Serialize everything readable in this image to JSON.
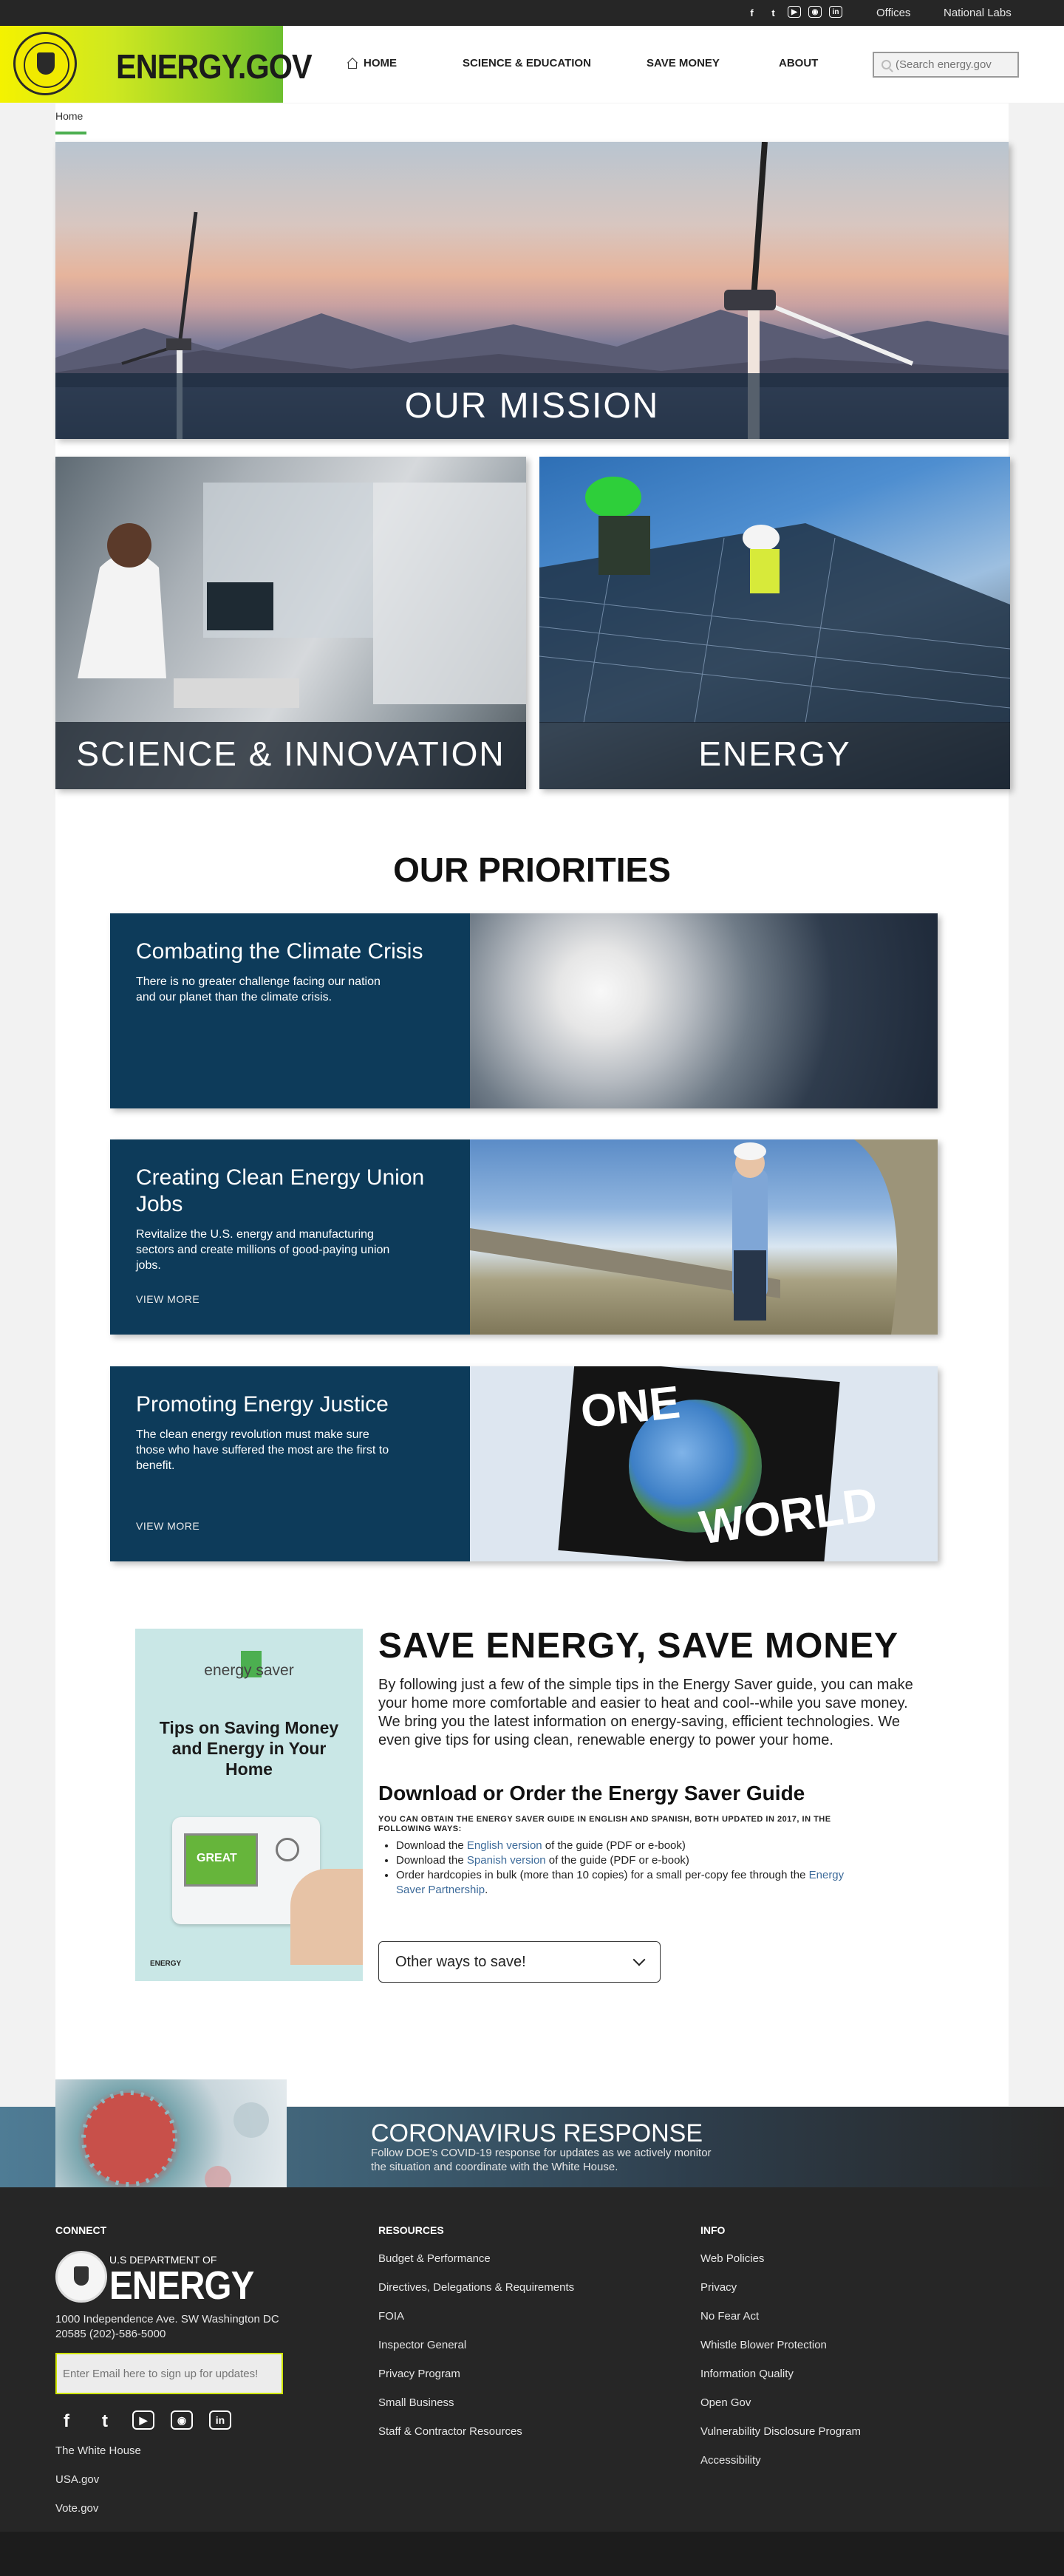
{
  "topbar": {
    "social_icons": [
      "f",
      "t",
      "▶",
      "◉",
      "in"
    ],
    "links": [
      "Offices",
      "National Labs"
    ]
  },
  "header": {
    "logo_text": "ENERGY.GOV",
    "nav": [
      "HOME",
      "SCIENCE & EDUCATION",
      "SAVE MONEY",
      "ABOUT"
    ],
    "search_placeholder": "(Search energy.gov"
  },
  "breadcrumb": "Home",
  "mission": {
    "title": "OUR MISSION"
  },
  "tiles": [
    "SCIENCE & INNOVATION",
    "ENERGY"
  ],
  "priorities": {
    "title": "OUR PRIORITIES",
    "cards": [
      {
        "title": "Combating the Climate Crisis",
        "text": "There is no greater challenge facing our nation and our planet than the climate crisis.",
        "more": ""
      },
      {
        "title": "Creating Clean Energy Union Jobs",
        "text": "Revitalize the U.S. energy and manufacturing sectors and create millions of good-paying union jobs.",
        "more": "VIEW MORE"
      },
      {
        "title": "Promoting Energy Justice",
        "text": "The clean energy revolution must make sure those who have suffered the most are the first to benefit.",
        "more": "VIEW MORE"
      }
    ],
    "world_image_text": [
      "ONE",
      "WORLD"
    ]
  },
  "saver": {
    "cover_brand": "energy saver",
    "cover_title": "Tips on Saving Money and Energy in Your Home",
    "cover_screen": "GREAT",
    "cover_footer": "ENERGY",
    "heading": "SAVE ENERGY, SAVE MONEY",
    "intro": "By following just a few of the simple tips in the Energy Saver guide, you can make your home more comfortable and easier to heat and cool--while you save money. We bring you the latest information on energy-saving, efficient technologies. We even give tips for using clean, renewable energy to power your home.",
    "subheading": "Download or Order the Energy Saver Guide",
    "small_caps": "YOU CAN OBTAIN THE ENERGY SAVER GUIDE IN ENGLISH AND SPANISH, BOTH UPDATED IN 2017, IN THE FOLLOWING WAYS:",
    "list": [
      {
        "before": "Download the ",
        "link": "English version",
        "after": " of the guide (PDF or e-book)"
      },
      {
        "before": "Download the ",
        "link": "Spanish version",
        "after": " of the guide (PDF or e-book)"
      },
      {
        "before": "Order hardcopies in bulk (more than 10 copies) for a small per-copy fee through the ",
        "link": "Energy Saver Partnership",
        "after": "."
      }
    ],
    "dropdown_label": "Other ways to save!"
  },
  "covid": {
    "title": "CORONAVIRUS RESPONSE",
    "text": "Follow DOE's COVID-19 response for updates as we actively monitor the situation and coordinate with the White House."
  },
  "footer": {
    "connect_heading": "CONNECT",
    "dept_line": "U.S DEPARTMENT OF",
    "dept_name": "ENERGY",
    "address": "1000 Independence Ave. SW Washington DC 20585 (202)-586-5000",
    "email_placeholder": "Enter Email here to sign up for updates!",
    "social_icons": [
      "f",
      "t",
      "▶",
      "◉",
      "in"
    ],
    "connect_links": [
      "The White House",
      "USA.gov",
      "Vote.gov"
    ],
    "resources_heading": "RESOURCES",
    "resources": [
      "Budget & Performance",
      "Directives, Delegations & Requirements",
      "FOIA",
      "Inspector General",
      "Privacy Program",
      "Small Business",
      "Staff & Contractor Resources"
    ],
    "info_heading": "INFO",
    "info": [
      "Web Policies",
      "Privacy",
      "No Fear Act",
      "Whistle Blower Protection",
      "Information Quality",
      "Open Gov",
      "Vulnerability Disclosure Program",
      "Accessibility"
    ]
  }
}
